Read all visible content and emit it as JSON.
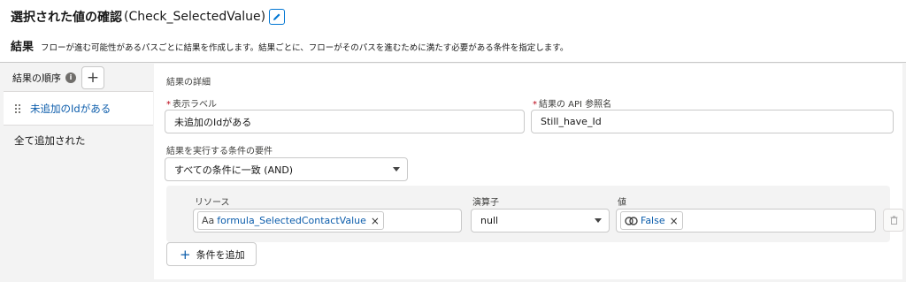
{
  "header": {
    "title": "選択された値の確認",
    "api_name": "(Check_SelectedValue)",
    "edit_icon": "pencil-icon"
  },
  "section": {
    "title": "結果",
    "description": "フローが進む可能性があるパスごとに結果を作成します。結果ごとに、フローがそのパスを進むために満たす必要がある条件を指定します。"
  },
  "sidebar": {
    "order_label": "結果の順序",
    "info_icon": "i",
    "add_icon": "+",
    "items": [
      {
        "label": "未追加のIdがある",
        "active": true
      },
      {
        "label": "全て追加された",
        "active": false
      }
    ]
  },
  "detail": {
    "heading": "結果の詳細",
    "label_field": {
      "required_mark": "*",
      "label": "表示ラベル",
      "value": "未追加のIdがある"
    },
    "api_field": {
      "required_mark": "*",
      "label": "結果の API 参照名",
      "value": "Still_have_Id"
    },
    "condition_req": {
      "label": "結果を実行する条件の要件",
      "value": "すべての条件に一致 (AND)"
    },
    "condition": {
      "resource_label": "リソース",
      "resource_icon_text": "Aa",
      "resource_value": "formula_SelectedContactValue",
      "operator_label": "演算子",
      "operator_value": "null",
      "value_label": "値",
      "value_value": "False"
    },
    "add_condition": {
      "plus": "+",
      "label": "条件を追加"
    }
  },
  "colors": {
    "accent": "#0176d3",
    "link": "#0b5cab",
    "required": "#ba0517",
    "panel": "#f3f3f3"
  }
}
